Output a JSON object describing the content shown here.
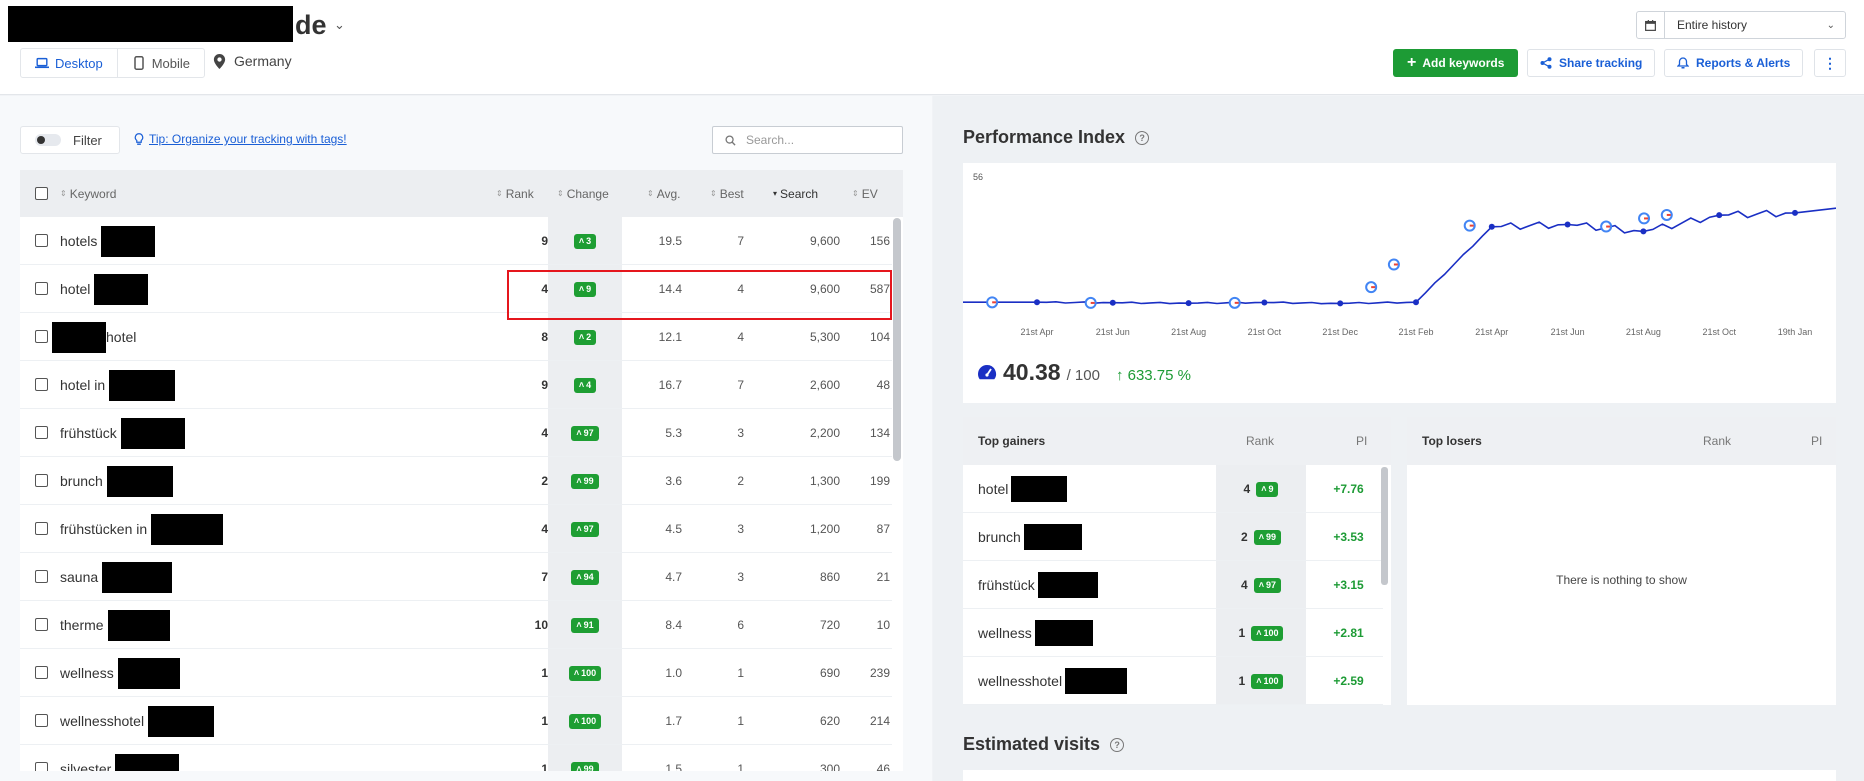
{
  "header": {
    "title_suffix": "de",
    "devices": [
      {
        "label": "Desktop",
        "active": true
      },
      {
        "label": "Mobile",
        "active": false
      }
    ],
    "location": "Germany",
    "date_range": "Entire history",
    "buttons": {
      "add_keywords": "Add keywords",
      "share_tracking": "Share tracking",
      "reports_alerts": "Reports & Alerts"
    }
  },
  "toolbar": {
    "filter_label": "Filter",
    "tip": "Tip: Organize your tracking with tags!",
    "search_placeholder": "Search..."
  },
  "table": {
    "columns": [
      "Keyword",
      "Rank",
      "Change",
      "Avg.",
      "Best",
      "Search",
      "EV"
    ],
    "sorted_column": "Search",
    "rows": [
      {
        "pre": "hotels",
        "redact": 54,
        "post": "",
        "rank": "9",
        "change": "3",
        "avg": "19.5",
        "best": "7",
        "search": "9,600",
        "ev": "156"
      },
      {
        "pre": "hotel",
        "redact": 54,
        "post": "",
        "rank": "4",
        "change": "9",
        "avg": "14.4",
        "best": "4",
        "search": "9,600",
        "ev": "587"
      },
      {
        "pre": "",
        "redact": 54,
        "post": "hotel",
        "rank": "8",
        "change": "2",
        "avg": "12.1",
        "best": "4",
        "search": "5,300",
        "ev": "104"
      },
      {
        "pre": "hotel in",
        "redact": 66,
        "post": "",
        "rank": "9",
        "change": "4",
        "avg": "16.7",
        "best": "7",
        "search": "2,600",
        "ev": "48"
      },
      {
        "pre": "frühstück",
        "redact": 64,
        "post": "",
        "rank": "4",
        "change": "97",
        "avg": "5.3",
        "best": "3",
        "search": "2,200",
        "ev": "134"
      },
      {
        "pre": "brunch",
        "redact": 66,
        "post": "",
        "rank": "2",
        "change": "99",
        "avg": "3.6",
        "best": "2",
        "search": "1,300",
        "ev": "199"
      },
      {
        "pre": "frühstücken in",
        "redact": 72,
        "post": "",
        "rank": "4",
        "change": "97",
        "avg": "4.5",
        "best": "3",
        "search": "1,200",
        "ev": "87"
      },
      {
        "pre": "sauna",
        "redact": 70,
        "post": "",
        "rank": "7",
        "change": "94",
        "avg": "4.7",
        "best": "3",
        "search": "860",
        "ev": "21"
      },
      {
        "pre": "therme",
        "redact": 62,
        "post": "",
        "rank": "10",
        "change": "91",
        "avg": "8.4",
        "best": "6",
        "search": "720",
        "ev": "10"
      },
      {
        "pre": "wellness",
        "redact": 62,
        "post": "",
        "rank": "1",
        "change": "100",
        "avg": "1.0",
        "best": "1",
        "search": "690",
        "ev": "239"
      },
      {
        "pre": "wellnesshotel",
        "redact": 66,
        "post": "",
        "rank": "1",
        "change": "100",
        "avg": "1.7",
        "best": "1",
        "search": "620",
        "ev": "214"
      },
      {
        "pre": "silvester",
        "redact": 64,
        "post": "",
        "rank": "1",
        "change": "99",
        "avg": "1.5",
        "best": "1",
        "search": "300",
        "ev": "46"
      }
    ]
  },
  "performance": {
    "title": "Performance Index",
    "y_top_label": "56",
    "x_labels": [
      "21st Apr",
      "21st Jun",
      "21st Aug",
      "21st Oct",
      "21st Dec",
      "21st Feb",
      "21st Apr",
      "21st Jun",
      "21st Aug",
      "21st Oct",
      "19th Jan"
    ],
    "score": "40.38",
    "score_max": "/ 100",
    "change_pct": "633.75 %",
    "line_color": "#1a2fc4"
  },
  "chart_data": {
    "type": "line",
    "x": [
      "21st Apr",
      "21st Jun",
      "21st Aug",
      "21st Oct",
      "21st Dec",
      "21st Feb",
      "21st Apr",
      "21st Jun",
      "21st Aug",
      "21st Oct",
      "19th Jan"
    ],
    "series": [
      {
        "values": [
          5.5,
          5.3,
          5.1,
          5.4,
          5.0,
          5.5,
          38,
          39,
          36,
          43,
          44
        ]
      }
    ],
    "ylim": [
      0,
      56
    ]
  },
  "gainers": {
    "title": "Top gainers",
    "col_rank": "Rank",
    "col_pi": "PI",
    "rows": [
      {
        "kw": "hotel",
        "redact": 56,
        "rank": "4",
        "change": "9",
        "pi": "+7.76"
      },
      {
        "kw": "brunch",
        "redact": 58,
        "rank": "2",
        "change": "99",
        "pi": "+3.53"
      },
      {
        "kw": "frühstück",
        "redact": 60,
        "rank": "4",
        "change": "97",
        "pi": "+3.15"
      },
      {
        "kw": "wellness",
        "redact": 58,
        "rank": "1",
        "change": "100",
        "pi": "+2.81"
      },
      {
        "kw": "wellnesshotel",
        "redact": 62,
        "rank": "1",
        "change": "100",
        "pi": "+2.59"
      }
    ]
  },
  "losers": {
    "title": "Top losers",
    "col_rank": "Rank",
    "col_pi": "PI",
    "empty_text": "There is nothing to show"
  },
  "estimated_visits": {
    "title": "Estimated visits"
  }
}
